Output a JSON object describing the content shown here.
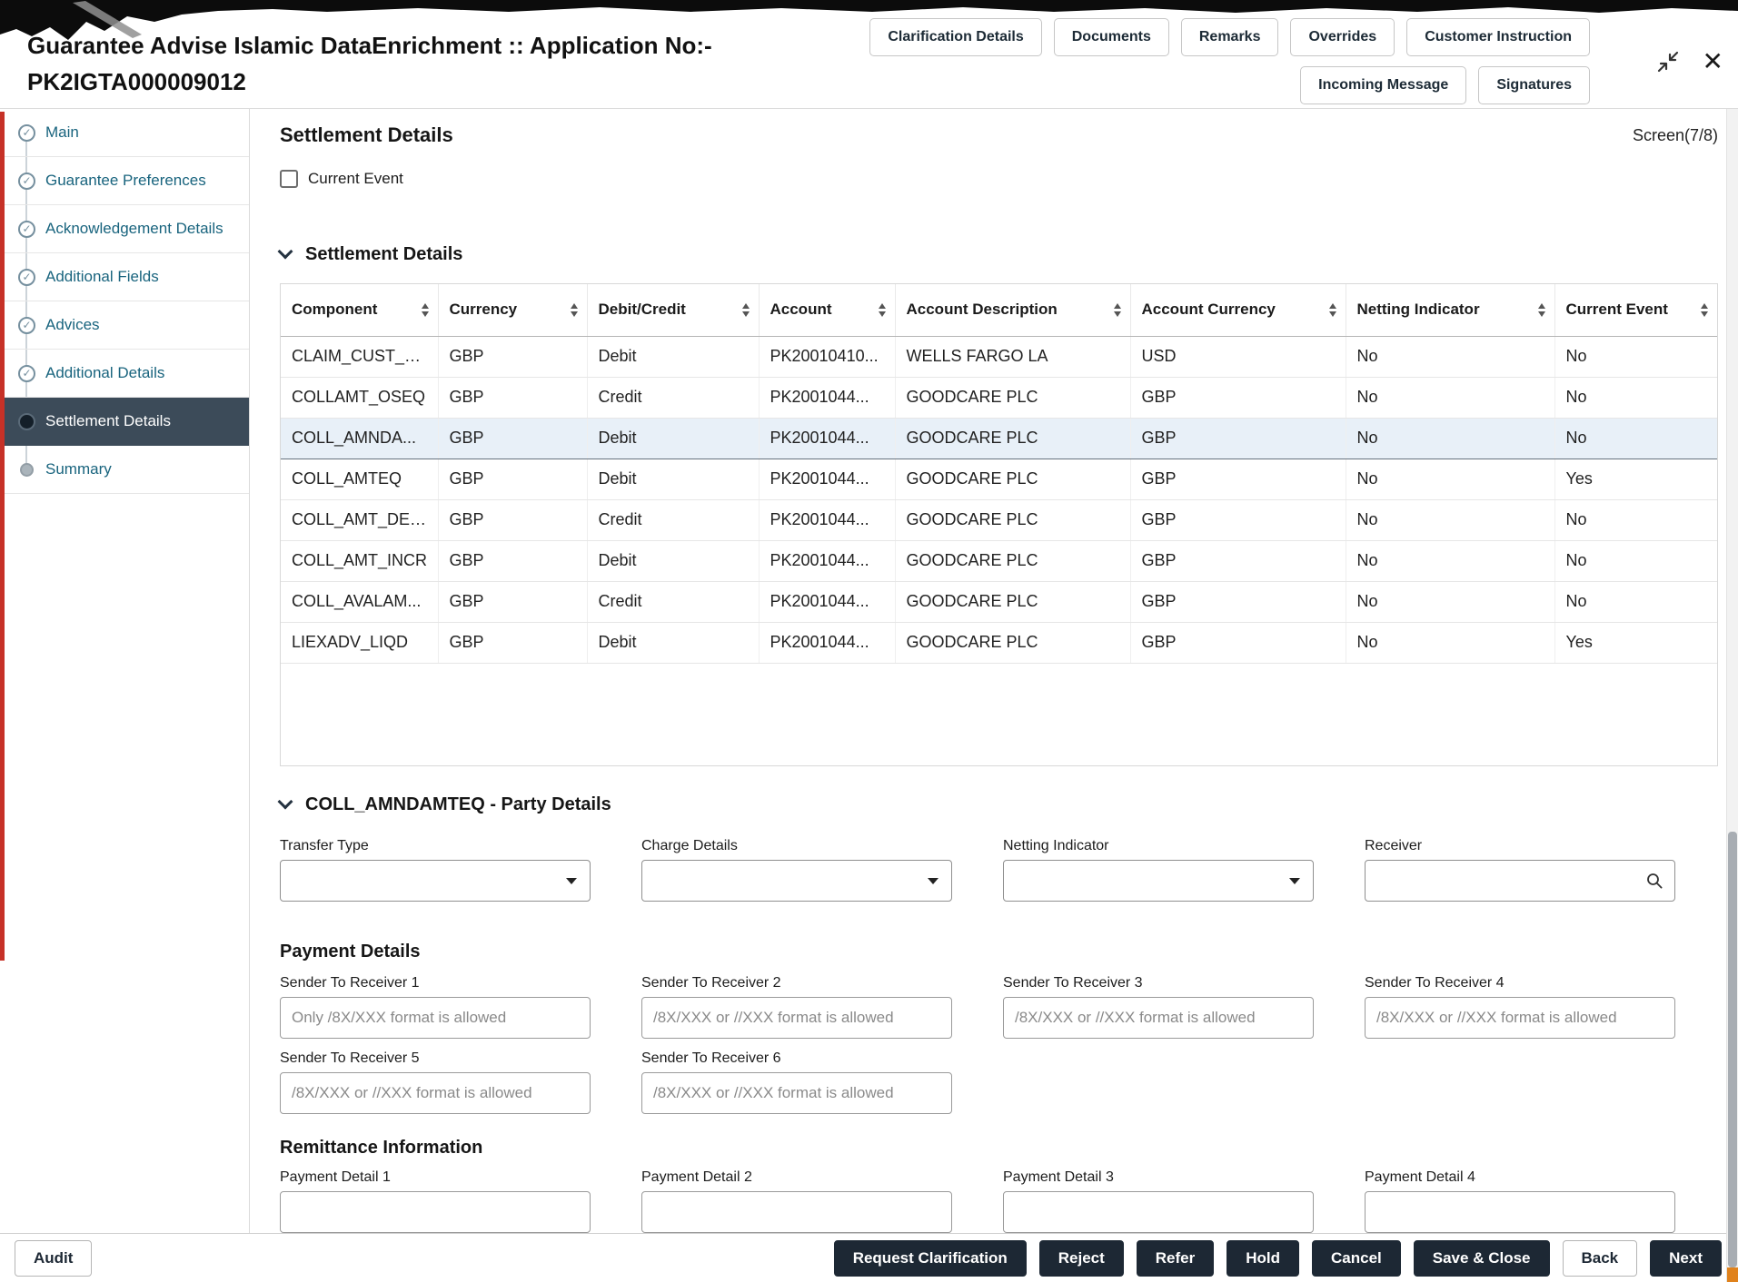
{
  "icons": {
    "check": "✓",
    "close": "✕",
    "collapse": "svg-collapse-arrows",
    "search": "svg-magnifier",
    "caret_down": "css-triangle-down",
    "chevron_down": "css-chevron",
    "sort": "css-triangle-up-down"
  },
  "colors": {
    "dark_button": "#1d2834",
    "sidebar_active": "#3c4b59",
    "sidebar_link": "#19647e",
    "selected_row": "#e8f0f8",
    "red_strip": "#c63127",
    "scroll_orange": "#e0821c"
  },
  "header": {
    "title_line1": "Guarantee Advise Islamic DataEnrichment :: Application No:-",
    "title_line2": "PK2IGTA000009012",
    "actions_row1": [
      "Clarification Details",
      "Documents",
      "Remarks",
      "Overrides",
      "Customer Instruction"
    ],
    "actions_row2": [
      "Incoming Message",
      "Signatures"
    ]
  },
  "sidebar": {
    "items": [
      {
        "label": "Main",
        "state": "done"
      },
      {
        "label": "Guarantee Preferences",
        "state": "done"
      },
      {
        "label": "Acknowledgement Details",
        "state": "done"
      },
      {
        "label": "Additional Fields",
        "state": "done"
      },
      {
        "label": "Advices",
        "state": "done"
      },
      {
        "label": "Additional Details",
        "state": "done"
      },
      {
        "label": "Settlement Details",
        "state": "active"
      },
      {
        "label": "Summary",
        "state": "pending"
      }
    ]
  },
  "page": {
    "title": "Settlement Details",
    "screen_indicator": "Screen(7/8)",
    "current_event_label": "Current Event",
    "current_event_checked": false
  },
  "settlement_table": {
    "section_title": "Settlement Details",
    "columns": [
      "Component",
      "Currency",
      "Debit/Credit",
      "Account",
      "Account Description",
      "Account Currency",
      "Netting Indicator",
      "Current Event"
    ],
    "rows": [
      [
        "CLAIM_CUST_A...",
        "GBP",
        "Debit",
        "PK20010410...",
        "WELLS FARGO LA",
        "USD",
        "No",
        "No"
      ],
      [
        "COLLAMT_OSEQ",
        "GBP",
        "Credit",
        "PK2001044...",
        "GOODCARE PLC",
        "GBP",
        "No",
        "No"
      ],
      [
        "COLL_AMNDA...",
        "GBP",
        "Debit",
        "PK2001044...",
        "GOODCARE PLC",
        "GBP",
        "No",
        "No"
      ],
      [
        "COLL_AMTEQ",
        "GBP",
        "Debit",
        "PK2001044...",
        "GOODCARE PLC",
        "GBP",
        "No",
        "Yes"
      ],
      [
        "COLL_AMT_DECR",
        "GBP",
        "Credit",
        "PK2001044...",
        "GOODCARE PLC",
        "GBP",
        "No",
        "No"
      ],
      [
        "COLL_AMT_INCR",
        "GBP",
        "Debit",
        "PK2001044...",
        "GOODCARE PLC",
        "GBP",
        "No",
        "No"
      ],
      [
        "COLL_AVALAM...",
        "GBP",
        "Credit",
        "PK2001044...",
        "GOODCARE PLC",
        "GBP",
        "No",
        "No"
      ],
      [
        "LIEXADV_LIQD",
        "GBP",
        "Debit",
        "PK2001044...",
        "GOODCARE PLC",
        "GBP",
        "No",
        "Yes"
      ]
    ],
    "selected_row_index": 2
  },
  "party_details": {
    "section_title": "COLL_AMNDAMTEQ - Party Details",
    "fields": [
      {
        "label": "Transfer Type",
        "type": "select",
        "value": ""
      },
      {
        "label": "Charge Details",
        "type": "select",
        "value": ""
      },
      {
        "label": "Netting Indicator",
        "type": "select",
        "value": ""
      },
      {
        "label": "Receiver",
        "type": "search",
        "value": ""
      }
    ]
  },
  "payment_details": {
    "title": "Payment Details",
    "fields": [
      {
        "label": "Sender To Receiver 1",
        "placeholder": "Only /8X/XXX format is allowed",
        "value": ""
      },
      {
        "label": "Sender To Receiver 2",
        "placeholder": "/8X/XXX or //XXX format is allowed",
        "value": ""
      },
      {
        "label": "Sender To Receiver 3",
        "placeholder": "/8X/XXX or //XXX format is allowed",
        "value": ""
      },
      {
        "label": "Sender To Receiver 4",
        "placeholder": "/8X/XXX or //XXX format is allowed",
        "value": ""
      },
      {
        "label": "Sender To Receiver 5",
        "placeholder": "/8X/XXX or //XXX format is allowed",
        "value": ""
      },
      {
        "label": "Sender To Receiver 6",
        "placeholder": "/8X/XXX or //XXX format is allowed",
        "value": ""
      }
    ]
  },
  "remittance": {
    "title": "Remittance Information",
    "fields": [
      {
        "label": "Payment Detail 1",
        "value": ""
      },
      {
        "label": "Payment Detail 2",
        "value": ""
      },
      {
        "label": "Payment Detail 3",
        "value": ""
      },
      {
        "label": "Payment Detail 4",
        "value": ""
      }
    ]
  },
  "footer": {
    "left_buttons": [
      {
        "label": "Audit",
        "style": "light"
      }
    ],
    "right_buttons": [
      {
        "label": "Request Clarification",
        "style": "dark"
      },
      {
        "label": "Reject",
        "style": "dark"
      },
      {
        "label": "Refer",
        "style": "dark"
      },
      {
        "label": "Hold",
        "style": "dark"
      },
      {
        "label": "Cancel",
        "style": "dark"
      },
      {
        "label": "Save & Close",
        "style": "dark"
      },
      {
        "label": "Back",
        "style": "light"
      },
      {
        "label": "Next",
        "style": "dark"
      }
    ]
  }
}
